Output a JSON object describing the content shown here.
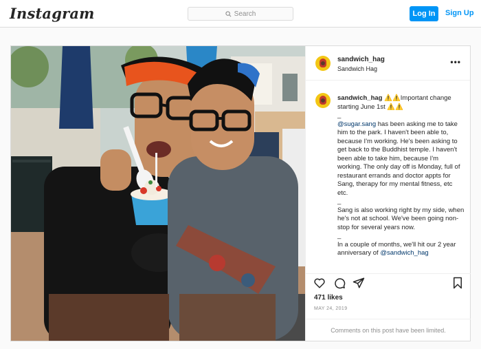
{
  "header": {
    "logo": "Instagram",
    "search_placeholder": "Search",
    "login_label": "Log In",
    "signup_label": "Sign Up"
  },
  "post": {
    "username": "sandwich_hag",
    "subtitle": "Sandwich Hag",
    "more_icon": "more-horizontal-icon",
    "caption": {
      "username": "sandwich_hag",
      "line1": "⚠️⚠️Important change starting June 1st ⚠️⚠️",
      "dash": "_",
      "p1_mention": "@sugar.sang",
      "p1_text": " has been asking me to take him to the park. I haven't been able to, because I'm working. He's been asking to get back to the Buddhist temple. I haven't been able to take him, because I'm working. The only day off is Monday, full of restaurant errands and doctor appts for Sang, therapy for my mental fitness, etc etc.",
      "p2": "Sang is also working right by my side, when he's not at school. We've been going non-stop for several years now.",
      "p3_text": "In a couple of months, we'll hit our 2 year anniversary of ",
      "p3_mention": "@sandwich_hag"
    },
    "likes": "471 likes",
    "date": "MAY 24, 2019",
    "comments_limited": "Comments on this post have been limited.",
    "icons": [
      "heart-icon",
      "comment-icon",
      "share-icon",
      "bookmark-icon"
    ]
  },
  "colors": {
    "accent": "#0095f6",
    "border": "#dbdbdb",
    "muted": "#8e8e8e"
  }
}
